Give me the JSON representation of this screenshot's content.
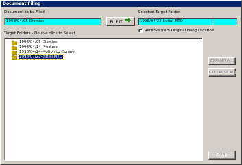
{
  "window": {
    "title": "Document Filing"
  },
  "document": {
    "label": "Document to be Filed",
    "value": "1998/04/05-Dismiss"
  },
  "file_it_button": {
    "label": "FILE IT"
  },
  "target": {
    "label": "Selected Target Folder",
    "value": "1998/07/22-Initial MTD"
  },
  "remove_checkbox": {
    "label": "Remove from Original Filing Location",
    "checked": false
  },
  "tree": {
    "label": "Target Folders - Double click to Select",
    "items": [
      {
        "label": "1998/04/05-Dismiss",
        "selected": false
      },
      {
        "label": "1998/04/14-Produce",
        "selected": false
      },
      {
        "label": "1998/04/24-Motion to Compel",
        "selected": false
      },
      {
        "label": "1998/07/22-Initial MTD",
        "selected": true
      }
    ]
  },
  "buttons": {
    "expand_all": "EXPAND ALL",
    "collapse_all": "COLLAPSE ALL",
    "done": "DONE"
  },
  "icons": {
    "folder": "folder-icon",
    "file_it": "arrow-right-icon"
  },
  "colors": {
    "title_bar": "#0a246a",
    "field_bg": "#00ffff",
    "window_bg": "#d4d0c8"
  }
}
